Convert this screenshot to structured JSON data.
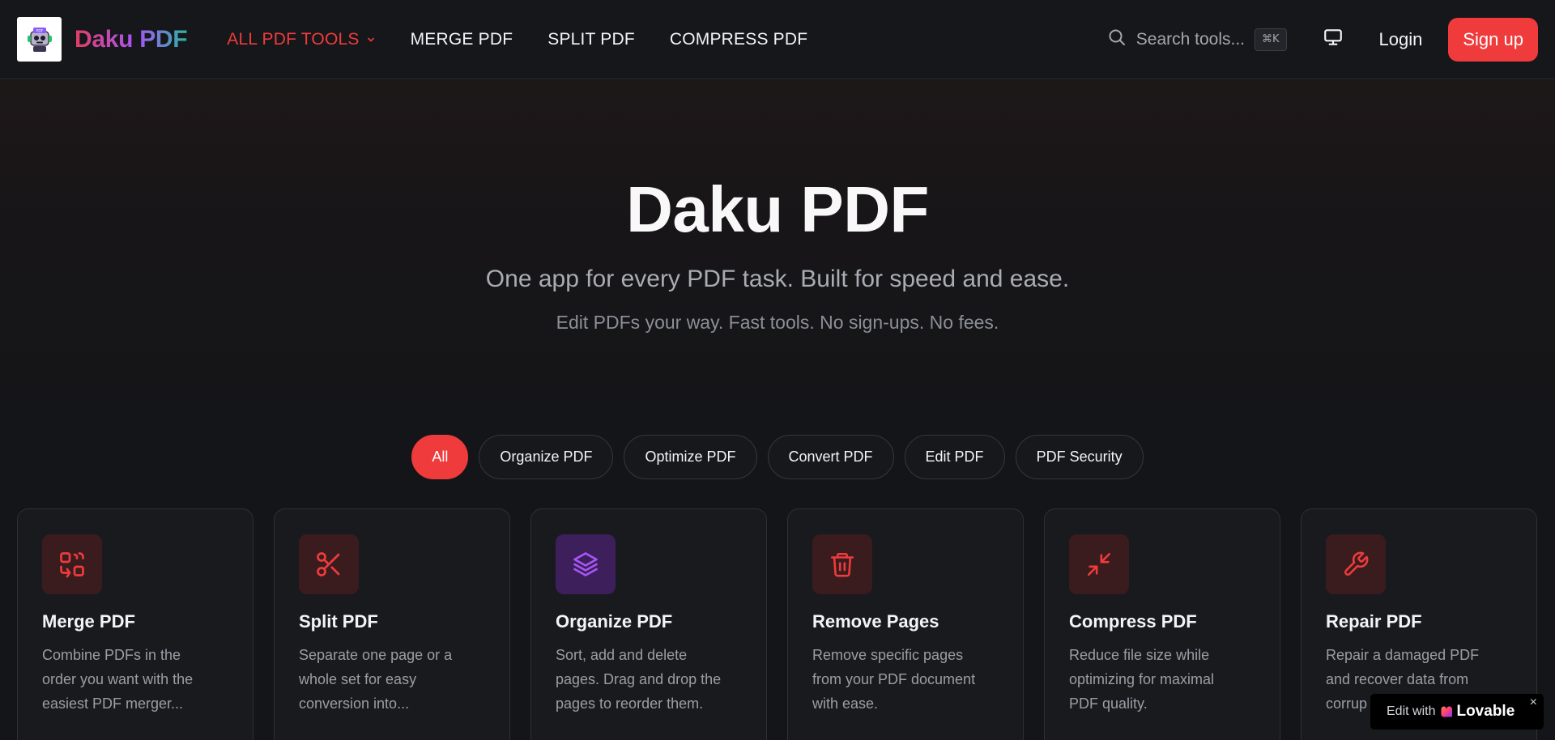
{
  "brand": {
    "name": "Daku PDF",
    "logo_icon": "robot-mascot-icon"
  },
  "nav": {
    "links": [
      {
        "label": "ALL PDF TOOLS",
        "active": true,
        "has_dropdown": true
      },
      {
        "label": "MERGE PDF",
        "active": false
      },
      {
        "label": "SPLIT PDF",
        "active": false
      },
      {
        "label": "COMPRESS PDF",
        "active": false
      }
    ],
    "search_placeholder": "Search tools...",
    "search_shortcut": "⌘K",
    "login_label": "Login",
    "signup_label": "Sign up"
  },
  "hero": {
    "title": "Daku PDF",
    "subtitle": "One app for every PDF task. Built for speed and ease.",
    "tagline": "Edit PDFs your way. Fast tools. No sign-ups. No fees."
  },
  "filters": [
    {
      "label": "All",
      "active": true
    },
    {
      "label": "Organize PDF",
      "active": false
    },
    {
      "label": "Optimize PDF",
      "active": false
    },
    {
      "label": "Convert PDF",
      "active": false
    },
    {
      "label": "Edit PDF",
      "active": false
    },
    {
      "label": "PDF Security",
      "active": false
    }
  ],
  "tools": [
    {
      "title": "Merge PDF",
      "desc_lines": [
        "Combine PDFs in the",
        "order you want with the",
        "easiest PDF merger..."
      ],
      "icon": "merge-icon"
    },
    {
      "title": "Split PDF",
      "desc_lines": [
        "Separate one page or a",
        "whole set for easy",
        "conversion into..."
      ],
      "icon": "scissors-icon"
    },
    {
      "title": "Organize PDF",
      "desc_lines": [
        "Sort, add and delete",
        "pages. Drag and drop the",
        "pages to reorder them."
      ],
      "icon": "layers-icon"
    },
    {
      "title": "Remove Pages",
      "desc_lines": [
        "Remove specific pages",
        "from your PDF document",
        "with ease."
      ],
      "icon": "trash-icon"
    },
    {
      "title": "Compress PDF",
      "desc_lines": [
        "Reduce file size while",
        "optimizing for maximal",
        "PDF quality."
      ],
      "icon": "compress-arrows-icon"
    },
    {
      "title": "Repair PDF",
      "desc_lines": [
        "Repair a damaged PDF",
        "and recover data from",
        "corrup"
      ],
      "icon": "wrench-icon"
    }
  ],
  "badge": {
    "edit_label": "Edit with",
    "name": "Lovable",
    "close": "×"
  },
  "colors": {
    "accent": "#ef3b3b",
    "background": "#141518",
    "card": "#191a1e",
    "purple": "#a855f7"
  }
}
